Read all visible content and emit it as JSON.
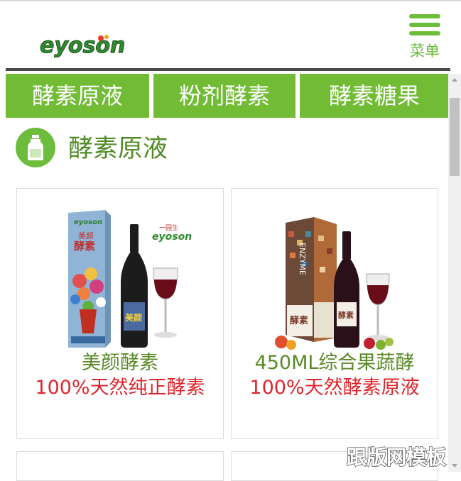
{
  "header": {
    "logo_text": "eyoson",
    "menu_label": "菜单"
  },
  "tabs": [
    "酵素原液",
    "粉剂酵素",
    "酵素糖果"
  ],
  "section": {
    "title": "酵素原液"
  },
  "products": [
    {
      "name": "美颜酵素",
      "desc": "100%天然纯正酵素",
      "box_brand": "eyoson",
      "box_text_small": "美颜",
      "box_text_large": "酵素",
      "bottle_label": "美颜",
      "corner_logo_top": "一园生",
      "corner_logo": "eyoson"
    },
    {
      "name": "450ML综合果蔬酵",
      "desc": "100%天然酵素原液",
      "box_vertical_text": "ENZYME",
      "box_label": "酵素",
      "bottle_label": "酵素"
    }
  ],
  "watermark": "跟版网模板",
  "colors": {
    "brand_green": "#72bc35",
    "name_green": "#5a8a28",
    "desc_red": "#e0242c"
  }
}
